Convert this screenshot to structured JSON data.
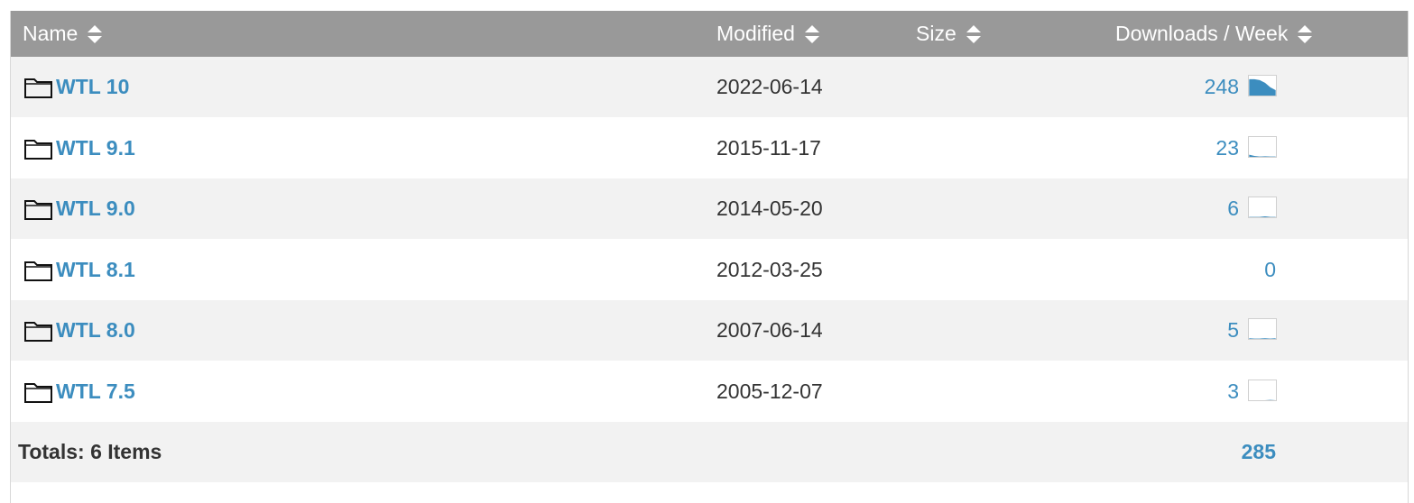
{
  "header": {
    "name_label": "Name",
    "modified_label": "Modified",
    "size_label": "Size",
    "downloads_label": "Downloads / Week"
  },
  "rows": [
    {
      "name": "WTL 10",
      "modified": "2022-06-14",
      "downloads": "248",
      "spark": [
        0.9,
        0.9,
        0.85,
        0.7,
        0.45,
        0.3
      ]
    },
    {
      "name": "WTL 9.1",
      "modified": "2015-11-17",
      "downloads": "23",
      "spark": [
        0.12,
        0.05,
        0.02,
        0.03,
        0.02,
        0.02
      ]
    },
    {
      "name": "WTL 9.0",
      "modified": "2014-05-20",
      "downloads": "6",
      "spark": [
        0.02,
        0.02,
        0.02,
        0.05,
        0.02,
        0.02
      ]
    },
    {
      "name": "WTL 8.1",
      "modified": "2012-03-25",
      "downloads": "0",
      "spark": []
    },
    {
      "name": "WTL 8.0",
      "modified": "2007-06-14",
      "downloads": "5",
      "spark": [
        0.04,
        0.02,
        0.02,
        0.04,
        0.02,
        0.04
      ]
    },
    {
      "name": "WTL 7.5",
      "modified": "2005-12-07",
      "downloads": "3",
      "spark": [
        0.0,
        0.0,
        0.0,
        0.0,
        0.02,
        0.0
      ]
    }
  ],
  "totals": {
    "label": "Totals: 6 Items",
    "downloads": "285"
  },
  "colors": {
    "header_bg": "#999999",
    "link": "#3c8dbf",
    "row_alt": "#f2f2f2",
    "spark_fill": "#3c8dbf"
  },
  "icons": {
    "sort": "sort-updown-icon",
    "folder": "folder-icon"
  }
}
